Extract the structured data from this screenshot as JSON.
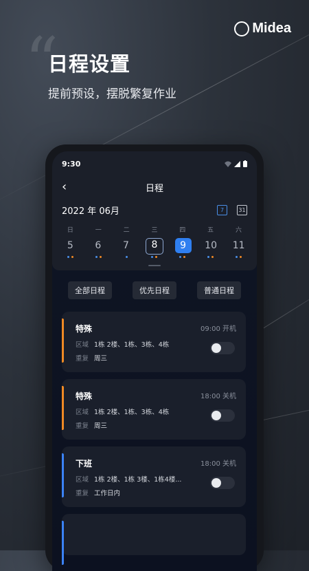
{
  "brand": {
    "name": "Midea"
  },
  "headline": {
    "title": "日程设置",
    "subtitle": "提前预设，摆脱繁复作业"
  },
  "phone": {
    "status": {
      "time": "9:30"
    },
    "nav": {
      "title": "日程"
    },
    "calendar": {
      "month_label": "2022 年 06月",
      "icon_today": "7",
      "icon_month": "31",
      "weekdays": [
        "日",
        "一",
        "二",
        "三",
        "四",
        "五",
        "六"
      ],
      "dates": [
        "5",
        "6",
        "7",
        "8",
        "9",
        "10",
        "11"
      ]
    },
    "filters": [
      "全部日程",
      "优先日程",
      "普通日程"
    ],
    "cards": [
      {
        "title": "特殊",
        "time": "09:00 开机",
        "area_key": "区域",
        "area": "1栋 2楼、1栋、3栋、4栋",
        "repeat_key": "重复",
        "repeat": "周三",
        "accent": "#f08a24"
      },
      {
        "title": "特殊",
        "time": "18:00 关机",
        "area_key": "区域",
        "area": "1栋 2楼、1栋、3栋、4栋",
        "repeat_key": "重复",
        "repeat": "周三",
        "accent": "#f08a24"
      },
      {
        "title": "下班",
        "time": "18:00 关机",
        "area_key": "区域",
        "area": "1栋 2楼、1栋 3楼、1栋4楼...",
        "repeat_key": "重复",
        "repeat": "工作日内",
        "accent": "#3b82f6"
      }
    ]
  },
  "colors": {
    "accent_blue": "#2f7ff0",
    "accent_orange": "#f08a24"
  }
}
